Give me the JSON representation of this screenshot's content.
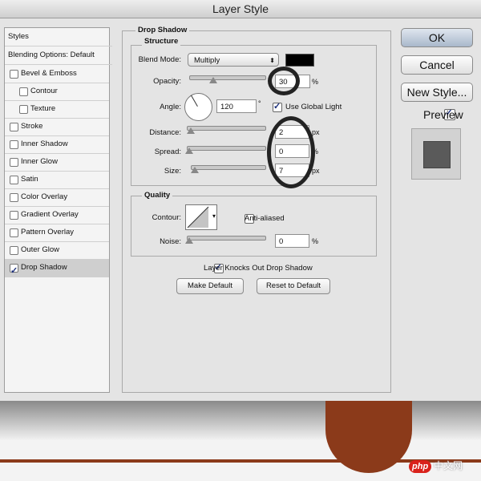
{
  "window": {
    "title": "Layer Style"
  },
  "sidebar": {
    "header": "Styles",
    "items": [
      {
        "label": "Blending Options: Default"
      },
      {
        "label": "Bevel & Emboss",
        "checked": false
      },
      {
        "label": "Contour",
        "checked": false
      },
      {
        "label": "Texture",
        "checked": false
      },
      {
        "label": "Stroke",
        "checked": false
      },
      {
        "label": "Inner Shadow",
        "checked": false
      },
      {
        "label": "Inner Glow",
        "checked": false
      },
      {
        "label": "Satin",
        "checked": false
      },
      {
        "label": "Color Overlay",
        "checked": false
      },
      {
        "label": "Gradient Overlay",
        "checked": false
      },
      {
        "label": "Pattern Overlay",
        "checked": false
      },
      {
        "label": "Outer Glow",
        "checked": false
      },
      {
        "label": "Drop Shadow",
        "checked": true
      }
    ]
  },
  "drop_shadow": {
    "title": "Drop Shadow",
    "structure": {
      "title": "Structure",
      "blend_mode_label": "Blend Mode:",
      "blend_mode_value": "Multiply",
      "shadow_color": "#000000",
      "opacity_label": "Opacity:",
      "opacity_value": "30",
      "opacity_unit": "%",
      "angle_label": "Angle:",
      "angle_value": "120",
      "angle_unit": "°",
      "use_global_light_label": "Use Global Light",
      "use_global_light": true,
      "distance_label": "Distance:",
      "distance_value": "2",
      "distance_unit": "px",
      "spread_label": "Spread:",
      "spread_value": "0",
      "spread_unit": "%",
      "size_label": "Size:",
      "size_value": "7",
      "size_unit": "px"
    },
    "quality": {
      "title": "Quality",
      "contour_label": "Contour:",
      "anti_aliased_label": "Anti-aliased",
      "anti_aliased": false,
      "noise_label": "Noise:",
      "noise_value": "0",
      "noise_unit": "%"
    },
    "knockout_label": "Layer Knocks Out Drop Shadow",
    "knockout": true,
    "make_default_label": "Make Default",
    "reset_default_label": "Reset to Default"
  },
  "buttons": {
    "ok": "OK",
    "cancel": "Cancel",
    "new_style": "New Style...",
    "preview_label": "Preview",
    "preview_checked": true
  },
  "colors": {
    "preview_swatch": "#5a5a5a",
    "brown_circle": "#8b3a1a",
    "watermark_red": "#d9221b"
  },
  "watermark": {
    "logo_text": "php",
    "site_text": "中文网"
  }
}
